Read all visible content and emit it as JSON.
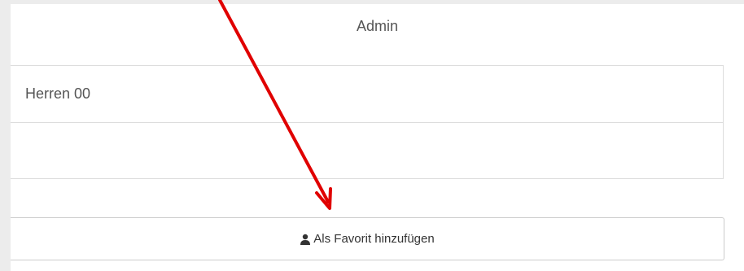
{
  "header": {
    "title": "Admin"
  },
  "table": {
    "rows": [
      {
        "value": "Herren 00"
      },
      {
        "value": ""
      }
    ]
  },
  "actions": {
    "favorite_label": "Als Favorit hinzufügen",
    "favorite_icon": "user-icon"
  },
  "annotation": {
    "arrow_color": "#e00000"
  }
}
